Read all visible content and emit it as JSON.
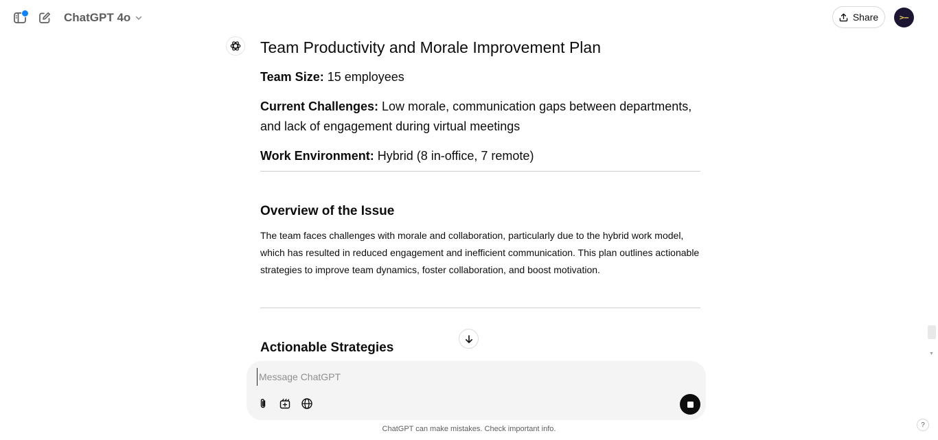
{
  "header": {
    "model_name": "ChatGPT 4o",
    "share_label": "Share",
    "avatar_text": ">–"
  },
  "message": {
    "title": "Team Productivity and Morale Improvement Plan",
    "team_size_label": "Team Size:",
    "team_size_value": " 15 employees",
    "challenges_label": "Current Challenges:",
    "challenges_value": " Low morale, communication gaps between departments, and lack of engagement during virtual meetings",
    "environment_label": "Work Environment:",
    "environment_value": " Hybrid (8 in-office, 7 remote)",
    "overview_heading": "Overview of the Issue",
    "overview_text": "The team faces challenges with morale and collaboration, particularly due to the hybrid work model, which has resulted in reduced engagement and inefficient communication. This plan outlines actionable strategies to improve team dynamics, foster collaboration, and boost motivation.",
    "strategies_heading": "Actionable Strategies"
  },
  "composer": {
    "placeholder": "Message ChatGPT",
    "value": ""
  },
  "footer": {
    "disclaimer": "ChatGPT can make mistakes. Check important info.",
    "help_label": "?"
  },
  "colors": {
    "notification_dot": "#0a84ff",
    "avatar_bg": "#1c1633",
    "avatar_fg": "#f3d14b",
    "composer_bg": "#f4f4f4"
  },
  "icons": [
    "sidebar-toggle-icon",
    "new-chat-icon",
    "chevron-down-icon",
    "share-upload-icon",
    "openai-logo-icon",
    "arrow-down-icon",
    "paperclip-icon",
    "tools-icon",
    "globe-icon",
    "stop-icon"
  ]
}
